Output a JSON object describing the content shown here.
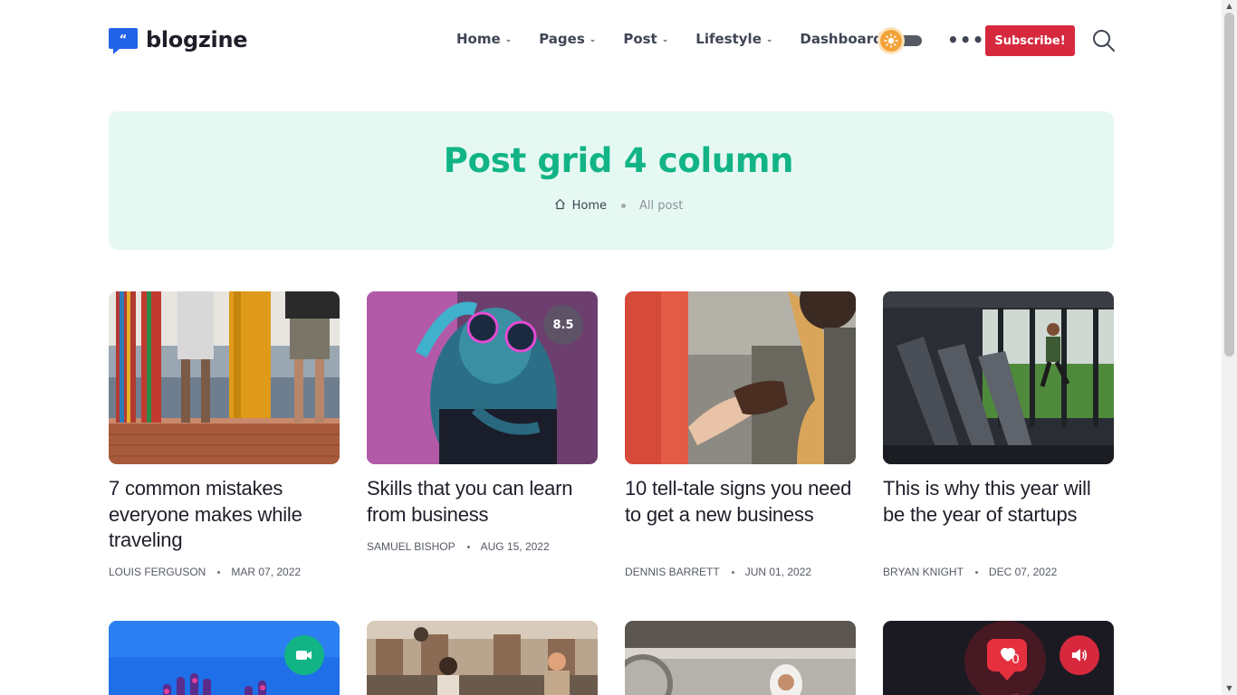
{
  "brand": {
    "name": "blogzine"
  },
  "nav": {
    "items": [
      {
        "label": "Home",
        "has_dropdown": true
      },
      {
        "label": "Pages",
        "has_dropdown": true
      },
      {
        "label": "Post",
        "has_dropdown": true
      },
      {
        "label": "Lifestyle",
        "has_dropdown": true
      },
      {
        "label": "Dashboard",
        "has_dropdown": false
      }
    ],
    "subscribe_label": "Subscribe!"
  },
  "banner": {
    "title": "Post grid 4 column",
    "breadcrumb": {
      "home": "Home",
      "current": "All post"
    }
  },
  "posts": [
    {
      "title": "7 common mistakes everyone makes while traveling",
      "author": "LOUIS FERGUSON",
      "date": "MAR 07, 2022"
    },
    {
      "title": "Skills that you can learn from business",
      "author": "SAMUEL BISHOP",
      "date": "AUG 15, 2022",
      "rating": "8.5"
    },
    {
      "title": "10 tell-tale signs you need to get a new business",
      "author": "DENNIS BARRETT",
      "date": "JUN 01, 2022"
    },
    {
      "title": "This is why this year will be the year of startups",
      "author": "BRYAN KNIGHT",
      "date": "DEC 07, 2022"
    }
  ],
  "posts_row2": [
    {
      "format_icon": "video-icon"
    },
    {
      "format_icon": null
    },
    {
      "format_icon": null
    },
    {
      "format_icon": "audio-icon"
    }
  ],
  "colors": {
    "accent": "#12b486",
    "subscribe": "#d6293e",
    "banner_bg": "#e6f8f2",
    "logo": "#2163e8"
  }
}
